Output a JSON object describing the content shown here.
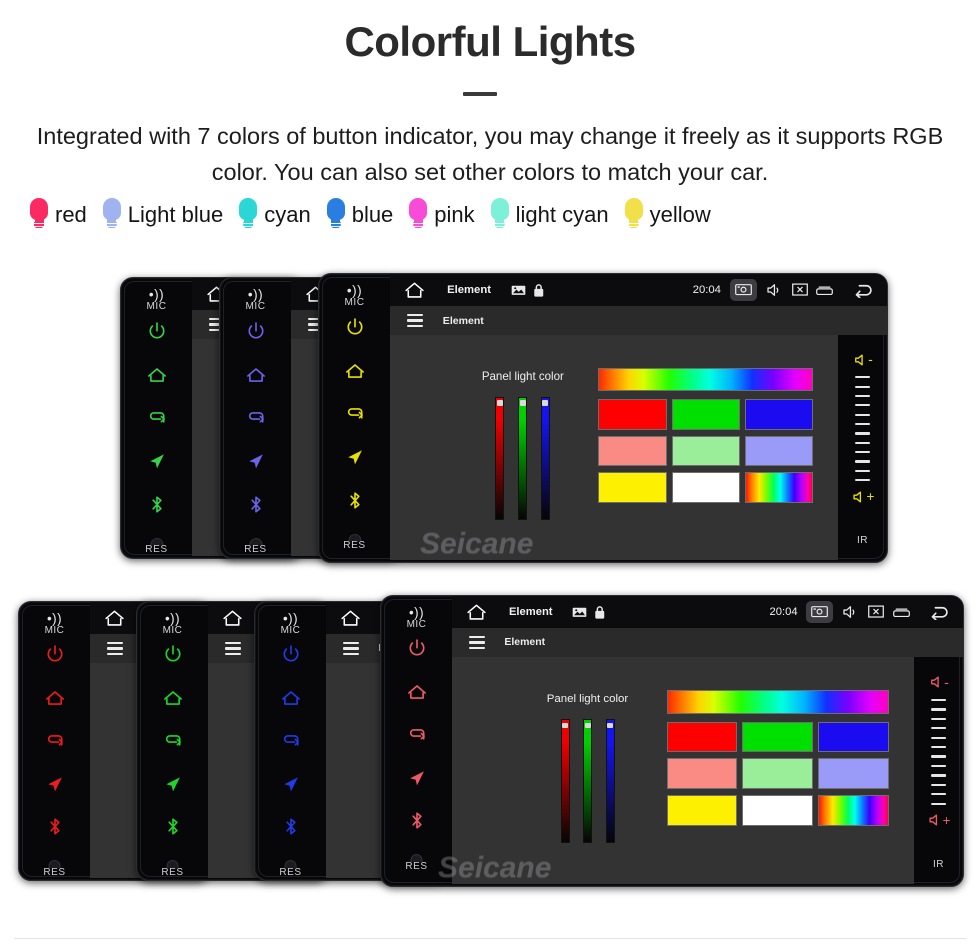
{
  "header": {
    "title": "Colorful Lights",
    "subtitle": "Integrated with 7 colors of button indicator, you may change it freely as it supports RGB color. You can also set other colors to match your car.",
    "bulbs": [
      {
        "label": "red",
        "color": "#fb2a63",
        "icon": "bulb-icon"
      },
      {
        "label": "Light blue",
        "color": "#9fb3f0",
        "icon": "bulb-icon"
      },
      {
        "label": "cyan",
        "color": "#2ad6d6",
        "icon": "bulb-icon"
      },
      {
        "label": "blue",
        "color": "#2a7de1",
        "icon": "bulb-icon"
      },
      {
        "label": "pink",
        "color": "#f84cd8",
        "icon": "bulb-icon"
      },
      {
        "label": "light cyan",
        "color": "#7df0d8",
        "icon": "bulb-icon"
      },
      {
        "label": "yellow",
        "color": "#f2e04a",
        "icon": "bulb-icon"
      }
    ]
  },
  "device": {
    "mic_label": "MIC",
    "res_label": "RES",
    "ir_label": "IR",
    "buttons": [
      {
        "name": "power-button",
        "icon": "power-icon"
      },
      {
        "name": "home-button",
        "icon": "home-icon"
      },
      {
        "name": "return-button",
        "icon": "return-arrow-icon"
      },
      {
        "name": "navigation-button",
        "icon": "navigation-arrow-icon"
      },
      {
        "name": "bluetooth-button",
        "icon": "bluetooth-icon"
      }
    ],
    "volume_down_label": "-",
    "volume_up_label": "+",
    "tick_count": 12,
    "statusbar": {
      "home_icon": "home-outline-icon",
      "title": "Element",
      "image_icon": "image-icon",
      "lock_icon": "lock-icon",
      "time": "20:04",
      "screenshot_icon": "screenshot-camera-icon",
      "mute_icon": "speaker-mute-icon",
      "close_icon": "close-window-icon",
      "recents_icon": "recent-apps-icon",
      "back_icon": "back-arrow-icon"
    },
    "appbar": {
      "menu_icon": "hamburger-menu-icon",
      "title": "Element"
    },
    "color_panel": {
      "label": "Panel light color",
      "sliders": [
        {
          "name": "red-channel-slider",
          "color": "#ee0000",
          "value": 96
        },
        {
          "name": "green-channel-slider",
          "color": "#00d000",
          "value": 94
        },
        {
          "name": "blue-channel-slider",
          "color": "#1414ee",
          "value": 92
        }
      ],
      "hue_bar": "hue-gradient-bar",
      "swatches": [
        {
          "name": "swatch-red",
          "color": "#ff0000"
        },
        {
          "name": "swatch-green",
          "color": "#00e000"
        },
        {
          "name": "swatch-blue",
          "color": "#1a0bf0"
        },
        {
          "name": "swatch-salmon",
          "color": "#fa8a84"
        },
        {
          "name": "swatch-light-green",
          "color": "#9aee9a"
        },
        {
          "name": "swatch-periwinkle",
          "color": "#9a9af8"
        },
        {
          "name": "swatch-yellow",
          "color": "#fdf000"
        },
        {
          "name": "swatch-white",
          "color": "#ffffff"
        },
        {
          "name": "swatch-rainbow",
          "color": "rainbow"
        }
      ]
    }
  },
  "groups": [
    {
      "name": "top-device-group",
      "watermark": "Seicane",
      "units": [
        {
          "name": "device-green",
          "led": "#38d14a"
        },
        {
          "name": "device-purple",
          "led": "#6a64e8"
        },
        {
          "name": "device-yellow-main",
          "led": "#e8e000"
        }
      ]
    },
    {
      "name": "bottom-device-group",
      "watermark": "Seicane",
      "units": [
        {
          "name": "device-red",
          "led": "#ee1c1c"
        },
        {
          "name": "device-green",
          "led": "#1fd628"
        },
        {
          "name": "device-blue",
          "led": "#1f3ce8"
        },
        {
          "name": "device-red-main",
          "led": "#f05a68"
        }
      ]
    }
  ]
}
